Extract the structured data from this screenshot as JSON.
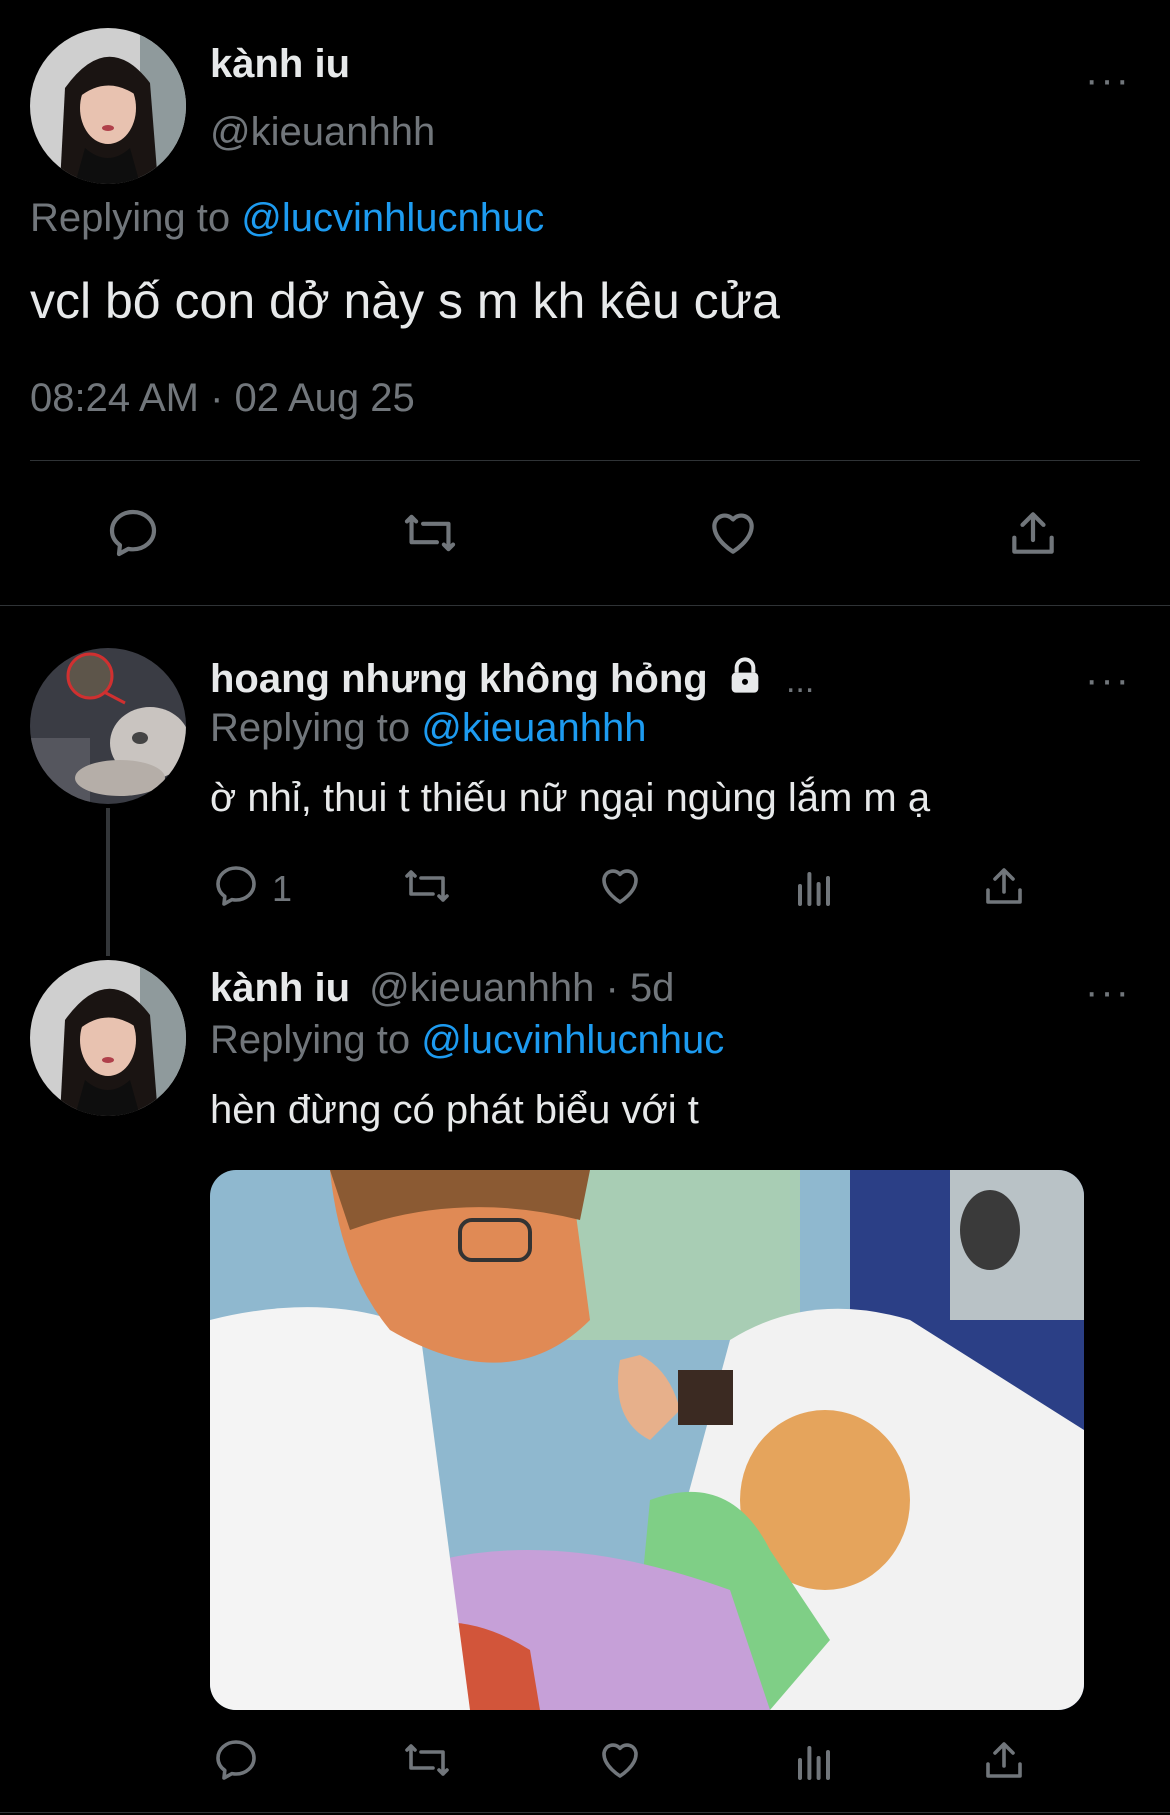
{
  "main_tweet": {
    "display_name": "kành iu",
    "handle": "@kieuanhhh",
    "replying_prefix": "Replying to",
    "replying_to": "@lucvinhlucnhuc",
    "text": "vcl bố con dở này s m kh kêu cửa",
    "timestamp": "08:24 AM · 02 Aug 25",
    "more": "···"
  },
  "reply1": {
    "display_name": "hoang nhưng không hỏng",
    "ellipsis": "...",
    "replying_prefix": "Replying to",
    "replying_to": "@kieuanhhh",
    "text": "ờ nhỉ, thui t thiếu nữ ngại ngùng lắm m ạ",
    "reply_count": "1",
    "more": "···"
  },
  "reply2": {
    "display_name": "kành iu",
    "handle_time": "@kieuanhhh · 5d",
    "replying_prefix": "Replying to",
    "replying_to": "@lucvinhlucnhuc",
    "text": "hèn đừng có phát biểu với t",
    "more": "···"
  },
  "icons": {
    "reply": "reply-icon",
    "retweet": "retweet-icon",
    "like": "heart-icon",
    "share": "share-icon",
    "views": "views-icon",
    "lock": "lock-icon"
  },
  "colors": {
    "background": "#000000",
    "text": "#e7e9ea",
    "secondary": "#71767b",
    "accent": "#1d9bf0"
  }
}
